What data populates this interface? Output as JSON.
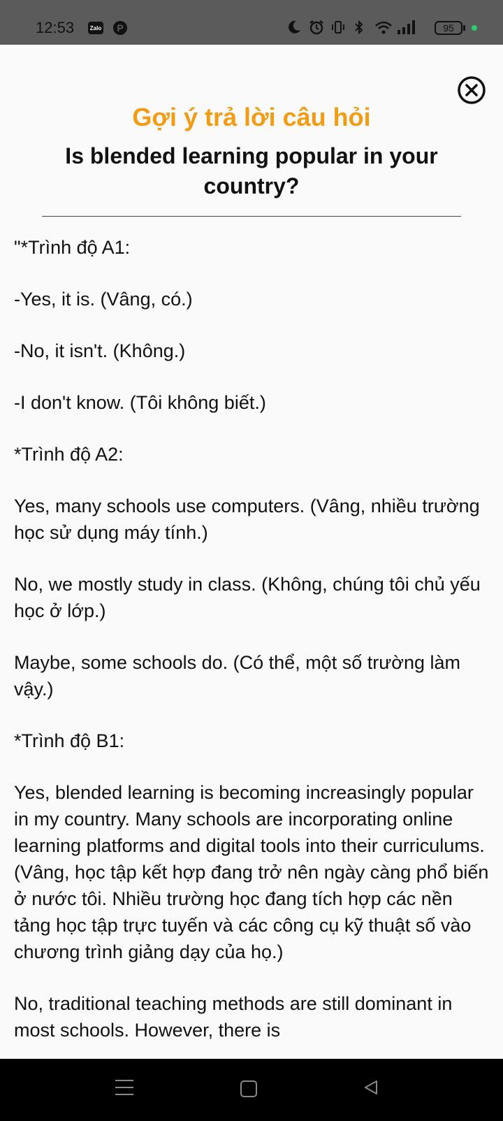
{
  "status_bar": {
    "time": "12:53",
    "battery": "95",
    "icons": [
      "zalo-icon",
      "pinterest-icon",
      "moon-icon",
      "alarm-icon",
      "vibrate-icon",
      "bluetooth-icon",
      "wifi-icon",
      "signal-icon",
      "battery-icon"
    ]
  },
  "modal": {
    "close_icon": "close-circle-icon",
    "heading": "Gợi ý trả lời câu hỏi",
    "question": "Is blended learning popular in your country?",
    "accent_color": "#f39c12",
    "paragraphs": [
      "\"*Trình độ A1:",
      "-Yes, it is. (Vâng, có.)",
      "-No, it isn't. (Không.)",
      "-I don't know. (Tôi không biết.)",
      "*Trình độ A2:",
      "Yes, many schools use computers. (Vâng, nhiều trường học sử dụng máy tính.)",
      "No, we mostly study in class. (Không, chúng tôi chủ yếu học ở lớp.)",
      "Maybe, some schools do. (Có thể, một số trường làm vậy.)",
      "*Trình độ B1:",
      "Yes, blended learning is becoming increasingly popular in my country. Many schools are incorporating online learning platforms and digital tools into their curriculums. (Vâng, học tập kết hợp đang trở nên ngày càng phổ biến ở nước tôi. Nhiều trường học đang tích hợp các nền tảng học tập trực tuyến và các công cụ kỹ thuật số vào chương trình giảng dạy của họ.)",
      "No, traditional teaching methods are still dominant in most schools. However, there is"
    ]
  },
  "nav_bar": {
    "icons": [
      "menu-icon",
      "home-icon",
      "back-icon"
    ]
  }
}
